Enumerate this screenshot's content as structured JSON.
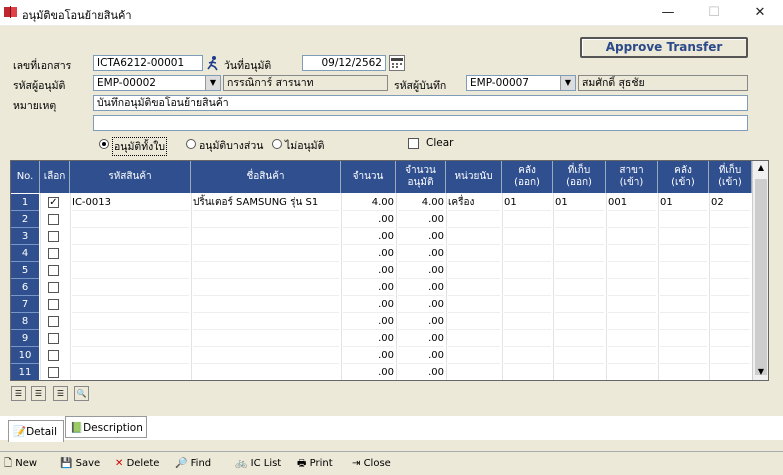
{
  "window": {
    "title": "อนุมัติขอโอนย้ายสินค้า",
    "minimize": "—",
    "maximize": "☐",
    "close": "✕"
  },
  "form": {
    "doc_no_label": "เลขที่เอกสาร",
    "doc_no": "ICTA6212-00001",
    "approve_date_label": "วันที่อนุมัติ",
    "approve_date": "09/12/2562",
    "approver_label": "รหัสผู้อนุมัติ",
    "approver_code": "EMP-00002",
    "approver_name": "กรรณิการ์ สารนาท",
    "recorder_label": "รหัสผู้บันทึก",
    "recorder_code": "EMP-00007",
    "recorder_name": "สมศักดิ์ สุธชัย",
    "remark_label": "หมายเหตุ",
    "remark1": "บันทึกอนุมัติขอโอนย้ายสินค้า",
    "remark2": "",
    "approve_button": "Approve Transfer",
    "radio_all": "อนุมัติทั้งใบ",
    "radio_partial": "อนุมัติบางส่วน",
    "radio_none": "ไม่อนุมัติ",
    "clear_label": "Clear"
  },
  "grid": {
    "headers": [
      "No.",
      "เลือก",
      "รหัสสินค้า",
      "ชื่อสินค้า",
      "จำนวน",
      "จำนวน\nอนุมัติ",
      "หน่วยนับ",
      "คลัง\n(ออก)",
      "ที่เก็บ\n(ออก)",
      "สาขา\n(เข้า)",
      "คลัง\n(เข้า)",
      "ที่เก็บ\n(เข้า)"
    ],
    "rows": [
      {
        "no": "1",
        "checked": true,
        "code": "IC-0013",
        "name": "ปริ้นเตอร์ SAMSUNG รุ่น S1",
        "qty": "4.00",
        "approved": "4.00",
        "unit": "เครื่อง",
        "wh_out": "01",
        "loc_out": "01",
        "branch_in": "001",
        "wh_in": "01",
        "loc_in": "02"
      },
      {
        "no": "2",
        "checked": false,
        "code": "",
        "name": "",
        "qty": ".00",
        "approved": ".00",
        "unit": "",
        "wh_out": "",
        "loc_out": "",
        "branch_in": "",
        "wh_in": "",
        "loc_in": ""
      },
      {
        "no": "3",
        "checked": false,
        "code": "",
        "name": "",
        "qty": ".00",
        "approved": ".00",
        "unit": "",
        "wh_out": "",
        "loc_out": "",
        "branch_in": "",
        "wh_in": "",
        "loc_in": ""
      },
      {
        "no": "4",
        "checked": false,
        "code": "",
        "name": "",
        "qty": ".00",
        "approved": ".00",
        "unit": "",
        "wh_out": "",
        "loc_out": "",
        "branch_in": "",
        "wh_in": "",
        "loc_in": ""
      },
      {
        "no": "5",
        "checked": false,
        "code": "",
        "name": "",
        "qty": ".00",
        "approved": ".00",
        "unit": "",
        "wh_out": "",
        "loc_out": "",
        "branch_in": "",
        "wh_in": "",
        "loc_in": ""
      },
      {
        "no": "6",
        "checked": false,
        "code": "",
        "name": "",
        "qty": ".00",
        "approved": ".00",
        "unit": "",
        "wh_out": "",
        "loc_out": "",
        "branch_in": "",
        "wh_in": "",
        "loc_in": ""
      },
      {
        "no": "7",
        "checked": false,
        "code": "",
        "name": "",
        "qty": ".00",
        "approved": ".00",
        "unit": "",
        "wh_out": "",
        "loc_out": "",
        "branch_in": "",
        "wh_in": "",
        "loc_in": ""
      },
      {
        "no": "8",
        "checked": false,
        "code": "",
        "name": "",
        "qty": ".00",
        "approved": ".00",
        "unit": "",
        "wh_out": "",
        "loc_out": "",
        "branch_in": "",
        "wh_in": "",
        "loc_in": ""
      },
      {
        "no": "9",
        "checked": false,
        "code": "",
        "name": "",
        "qty": ".00",
        "approved": ".00",
        "unit": "",
        "wh_out": "",
        "loc_out": "",
        "branch_in": "",
        "wh_in": "",
        "loc_in": ""
      },
      {
        "no": "10",
        "checked": false,
        "code": "",
        "name": "",
        "qty": ".00",
        "approved": ".00",
        "unit": "",
        "wh_out": "",
        "loc_out": "",
        "branch_in": "",
        "wh_in": "",
        "loc_in": ""
      },
      {
        "no": "11",
        "checked": false,
        "code": "",
        "name": "",
        "qty": ".00",
        "approved": ".00",
        "unit": "",
        "wh_out": "",
        "loc_out": "",
        "branch_in": "",
        "wh_in": "",
        "loc_in": ""
      }
    ]
  },
  "tabs": {
    "detail": "Detail",
    "description": "Description"
  },
  "toolbar": {
    "new": "New",
    "save": "Save",
    "delete": "Delete",
    "find": "Find",
    "ic_list": "IC List",
    "print": "Print",
    "close": "Close"
  },
  "colors": {
    "grid_header": "#2f4f8f",
    "form_bg": "#ece9d8",
    "approve_text": "#2c4a8a"
  }
}
